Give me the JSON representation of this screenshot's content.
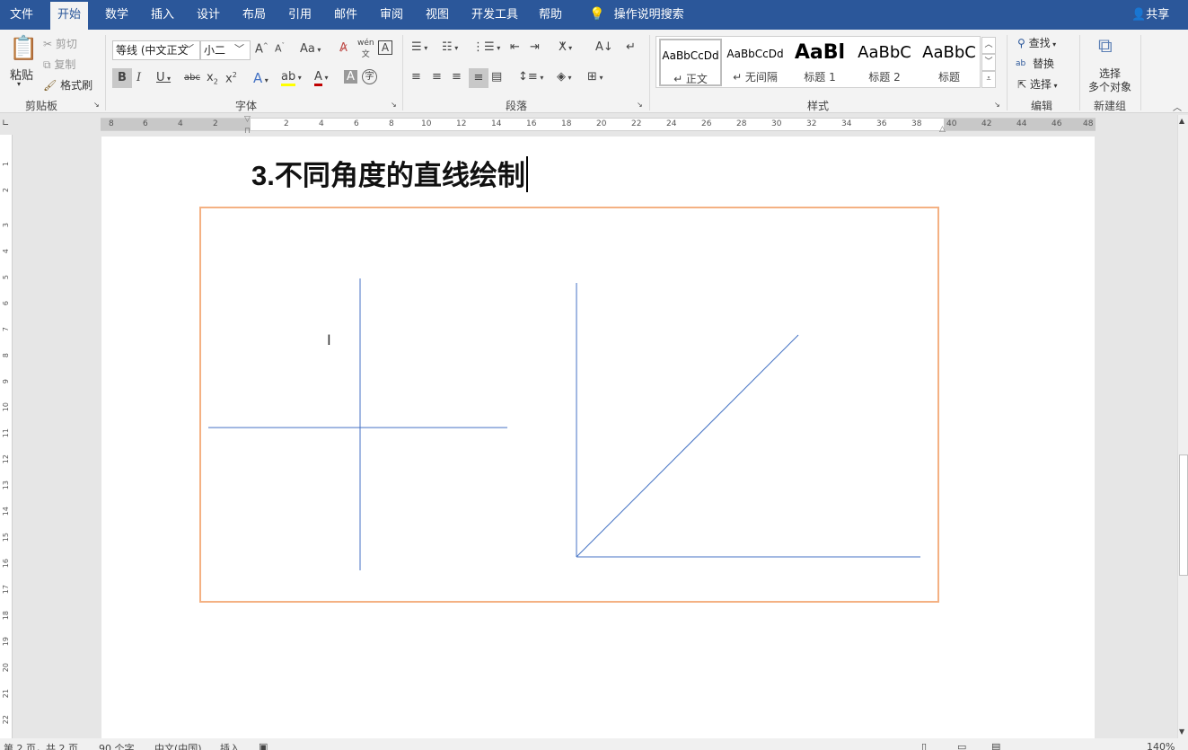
{
  "tabs": [
    "文件",
    "开始",
    "数学",
    "插入",
    "设计",
    "布局",
    "引用",
    "邮件",
    "审阅",
    "视图",
    "开发工具",
    "帮助"
  ],
  "search": "操作说明搜索",
  "share": "共享",
  "clipboard": {
    "paste": "粘贴",
    "cut": "剪切",
    "copy": "复制",
    "format_painter": "格式刷",
    "label": "剪贴板"
  },
  "font": {
    "name": "等线 (中文正文",
    "size": "小二",
    "label": "字体",
    "case": "Aa"
  },
  "paragraph": {
    "label": "段落"
  },
  "styles": {
    "label": "样式",
    "items": [
      {
        "preview": "AaBbCcDd",
        "name": "↵ 正文"
      },
      {
        "preview": "AaBbCcDd",
        "name": "↵ 无间隔"
      },
      {
        "preview": "AaBl",
        "name": "标题 1"
      },
      {
        "preview": "AaBbC",
        "name": "标题 2"
      },
      {
        "preview": "AaBbC",
        "name": "标题"
      }
    ]
  },
  "editing": {
    "find": "查找",
    "replace": "替换",
    "select": "选择",
    "label": "编辑"
  },
  "newgroup": {
    "select_objects_line1": "选择",
    "select_objects_line2": "多个对象",
    "label": "新建组"
  },
  "ruler_labels": [
    "8",
    "6",
    "4",
    "2",
    "2",
    "4",
    "6",
    "8",
    "10",
    "12",
    "14",
    "16",
    "18",
    "20",
    "22",
    "24",
    "26",
    "28",
    "30",
    "32",
    "34",
    "36",
    "38",
    "40",
    "42",
    "44",
    "46",
    "48"
  ],
  "vruler_labels": [
    "1",
    "2",
    "3",
    "4",
    "5",
    "6",
    "7",
    "8",
    "9",
    "10",
    "11",
    "12",
    "13",
    "14",
    "15",
    "16",
    "17",
    "18",
    "19",
    "20",
    "21",
    "22"
  ],
  "document": {
    "heading": "3.不同角度的直线绘制"
  },
  "status": {
    "page": "第 2 页，共 2 页",
    "words": "90 个字",
    "lang": "中文(中国)",
    "mode": "插入",
    "zoom": "140%"
  },
  "colors": {
    "accent": "#2b579a",
    "frame": "#f4b183",
    "line": "#4472c4"
  }
}
